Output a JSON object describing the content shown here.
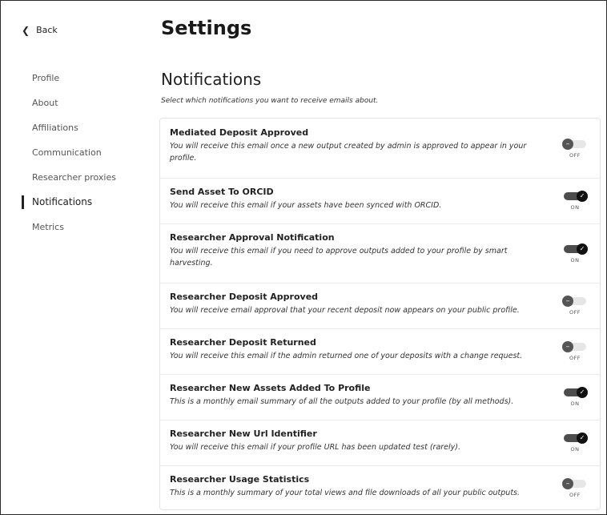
{
  "nav": {
    "back_label": "Back"
  },
  "page": {
    "title": "Settings"
  },
  "sidebar": {
    "items": [
      {
        "label": "Profile"
      },
      {
        "label": "About"
      },
      {
        "label": "Affiliations"
      },
      {
        "label": "Communication"
      },
      {
        "label": "Researcher proxies"
      },
      {
        "label": "Notifications",
        "active": true
      },
      {
        "label": "Metrics"
      }
    ]
  },
  "section": {
    "title": "Notifications",
    "description": "Select which notifications you want to receive emails about."
  },
  "notifications": [
    {
      "title": "Mediated Deposit Approved",
      "description": "You will receive this email once a new output created by admin is approved to appear in your profile.",
      "state": "OFF"
    },
    {
      "title": "Send Asset To ORCID",
      "description": "You will receive this email if your assets have been synced with ORCID.",
      "state": "ON"
    },
    {
      "title": "Researcher Approval Notification",
      "description": "You will receive this email if you need to approve outputs added to your profile by smart harvesting.",
      "state": "ON"
    },
    {
      "title": "Researcher Deposit Approved",
      "description": "You will receive email approval that your recent deposit now appears on your public profile.",
      "state": "OFF"
    },
    {
      "title": "Researcher Deposit Returned",
      "description": "You will receive this email if the admin returned one of your deposits with a change request.",
      "state": "OFF"
    },
    {
      "title": "Researcher New Assets Added To Profile",
      "description": "This is a monthly email summary of all the outputs added to your profile (by all methods).",
      "state": "ON"
    },
    {
      "title": "Researcher New Url Identifier",
      "description": "You will receive this email if your profile URL has been updated test (rarely).",
      "state": "ON"
    },
    {
      "title": "Researcher Usage Statistics",
      "description": "This is a monthly summary of your total views and file downloads of all your public outputs.",
      "state": "OFF"
    }
  ],
  "icons": {
    "back": "chevron-left-icon",
    "toggle_on": "check-icon",
    "toggle_off": "minus-icon"
  },
  "colors": {
    "toggle_on_track": "#4d4d4d",
    "toggle_on_knob": "#111111",
    "toggle_off_track": "#e6e6e6",
    "toggle_off_knob": "#555555"
  }
}
